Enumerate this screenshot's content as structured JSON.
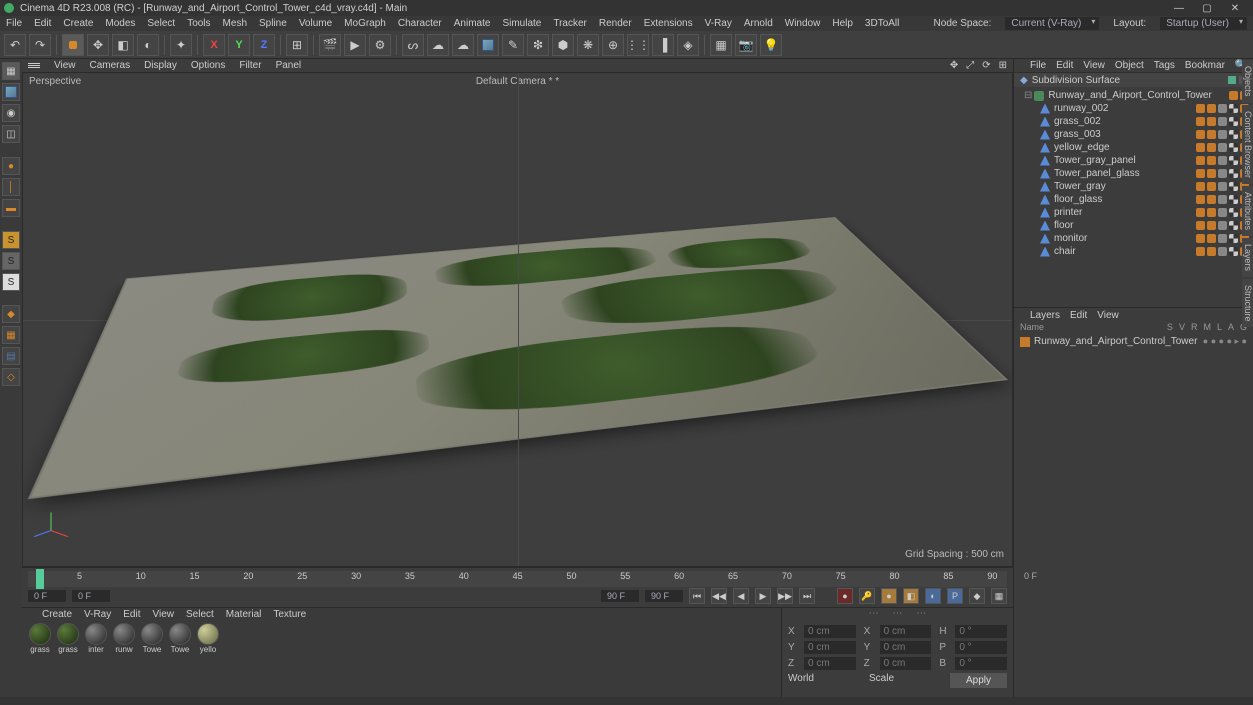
{
  "app": {
    "title": "Cinema 4D R23.008 (RC) - [Runway_and_Airport_Control_Tower_c4d_vray.c4d] - Main"
  },
  "window_buttons": {
    "min": "—",
    "max": "▢",
    "close": "✕"
  },
  "menu": [
    "File",
    "Edit",
    "Create",
    "Modes",
    "Select",
    "Tools",
    "Mesh",
    "Spline",
    "Volume",
    "MoGraph",
    "Character",
    "Animate",
    "Simulate",
    "Tracker",
    "Render",
    "Extensions",
    "V-Ray",
    "Arnold",
    "Window",
    "Help",
    "3DToAll"
  ],
  "menu_right": {
    "nodespace_label": "Node Space:",
    "nodespace_value": "Current (V-Ray)",
    "layout_label": "Layout:",
    "layout_value": "Startup (User)"
  },
  "viewport_menu": [
    "View",
    "Cameras",
    "Display",
    "Options",
    "Filter",
    "Panel"
  ],
  "viewport": {
    "label": "Perspective",
    "camera": "Default Camera * *",
    "gridspacing": "Grid Spacing : 500 cm"
  },
  "timeline": {
    "ticks": [
      "5",
      "10",
      "15",
      "20",
      "25",
      "30",
      "35",
      "40",
      "45",
      "50",
      "55",
      "60",
      "65",
      "70",
      "75",
      "80",
      "85",
      "90"
    ],
    "start": "0 F",
    "current": "0 F",
    "range": "90 F",
    "end": "90 F",
    "frame_display": "0 F"
  },
  "material_menu": [
    "Create",
    "V-Ray",
    "Edit",
    "View",
    "Select",
    "Material",
    "Texture"
  ],
  "materials": [
    "grass",
    "grass",
    "inter",
    "runw",
    "Towe",
    "Towe",
    "yello"
  ],
  "coords": {
    "X": "0 cm",
    "Y": "0 cm",
    "Z": "0 cm",
    "sX": "0 cm",
    "sY": "0 cm",
    "sZ": "0 cm",
    "H": "0 °",
    "P": "0 °",
    "B": "0 °",
    "world": "World",
    "scale": "Scale",
    "apply": "Apply"
  },
  "objpanel": {
    "menu": [
      "File",
      "Edit",
      "View",
      "Object",
      "Tags",
      "Bookmar"
    ],
    "subhead": "Subdivision Surface",
    "root": "Runway_and_Airport_Control_Tower",
    "children": [
      "runway_002",
      "grass_002",
      "grass_003",
      "yellow_edge",
      "Tower_gray_panel",
      "Tower_panel_glass",
      "Tower_gray",
      "floor_glass",
      "printer",
      "floor",
      "monitor",
      "chair"
    ]
  },
  "layers": {
    "menu": [
      "Layers",
      "Edit",
      "View"
    ],
    "cols": [
      "Name",
      "S",
      "V",
      "R",
      "M",
      "L",
      "A",
      "G"
    ],
    "row": "Runway_and_Airport_Control_Tower"
  },
  "sidetabs": [
    "Objects",
    "Content Browser",
    "Attributes",
    "Layers",
    "Structure"
  ]
}
